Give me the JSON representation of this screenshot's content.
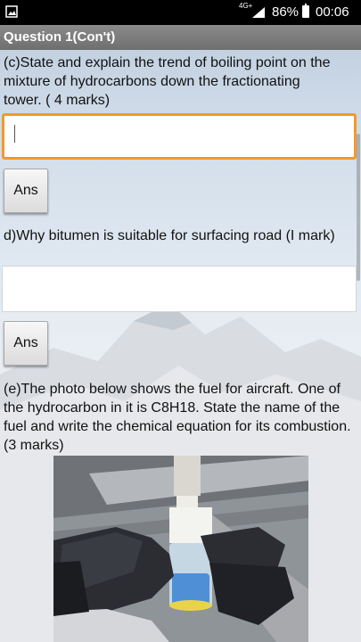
{
  "status_bar": {
    "network": "4G+",
    "battery_percent": "86%",
    "time": "00:06"
  },
  "header": {
    "title": "Question 1(Con't)"
  },
  "questions": [
    {
      "prompt": "(c)State and explain the trend of boiling point on the mixture of hydrocarbons down the fractionating tower. ( 4 marks)",
      "answer_value": "",
      "button_label": "Ans"
    },
    {
      "prompt": "d)Why bitumen is suitable for surfacing road (I mark)",
      "answer_value": "",
      "button_label": "Ans"
    },
    {
      "prompt": "(e)The photo below shows the fuel for aircraft. One of the hydrocarbon in it is C8H18. State the name of the fuel and write the chemical equation for its combustion. (3 marks)"
    }
  ],
  "colors": {
    "focus_border": "#f29a26",
    "titlebar": "#7a7a7a"
  }
}
